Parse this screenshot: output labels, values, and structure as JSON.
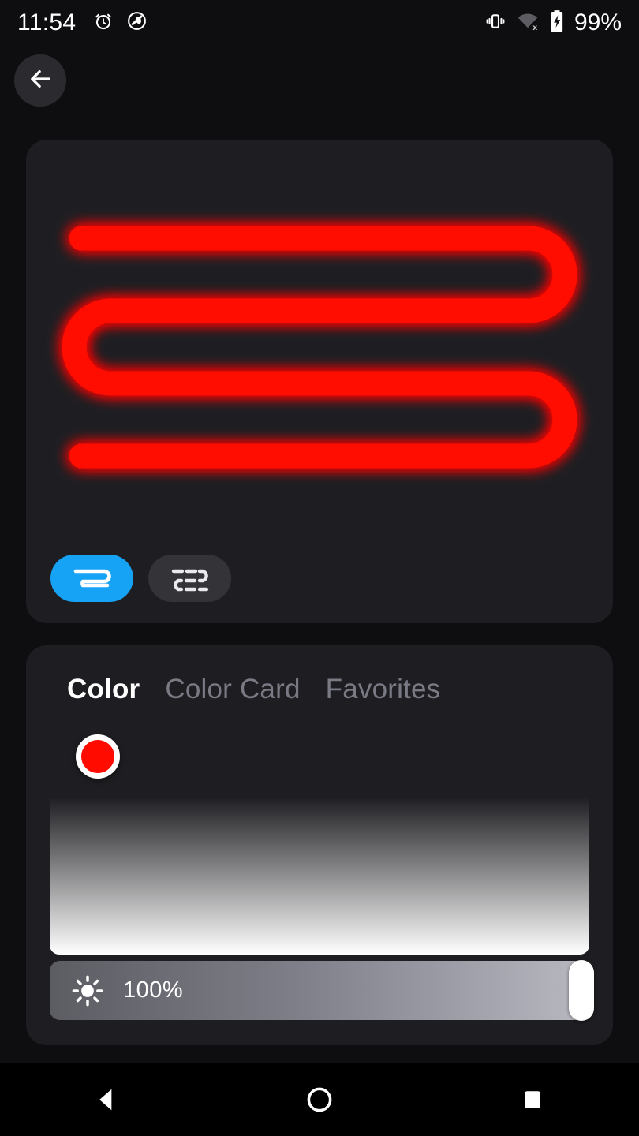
{
  "status_bar": {
    "time": "11:54",
    "battery_percent": "99%",
    "icons": [
      "alarm-icon",
      "do-not-disturb-icon",
      "vibrate-icon",
      "wifi-off-icon",
      "battery-charging-icon"
    ]
  },
  "header": {
    "back_label": "Back"
  },
  "preview": {
    "strip_color": "#ff0d00",
    "glow_color": "#ff2a14",
    "card_bg": "#1e1e22",
    "layout_modes": [
      {
        "id": "continuous",
        "label": "Continuous strip layout",
        "icon": "serpentine-continuous-icon",
        "active": true
      },
      {
        "id": "segmented",
        "label": "Segmented strip layout",
        "icon": "serpentine-segmented-icon",
        "active": false
      }
    ],
    "active_color": "#16a3f5",
    "inactive_color": "#333338"
  },
  "color_panel": {
    "tabs": [
      {
        "label": "Color",
        "active": true
      },
      {
        "label": "Color Card",
        "active": false
      },
      {
        "label": "Favorites",
        "active": false
      }
    ],
    "selected_color": "#ff0b00",
    "selector": {
      "x_percent": 4,
      "y_percent": 5
    },
    "brightness": {
      "icon": "brightness-sun-icon",
      "value": "100%",
      "percent": 100
    }
  },
  "navigation_bar": {
    "buttons": [
      {
        "name": "back",
        "icon": "triangle-back-icon"
      },
      {
        "name": "home",
        "icon": "circle-home-icon"
      },
      {
        "name": "recents",
        "icon": "square-recents-icon"
      }
    ]
  }
}
